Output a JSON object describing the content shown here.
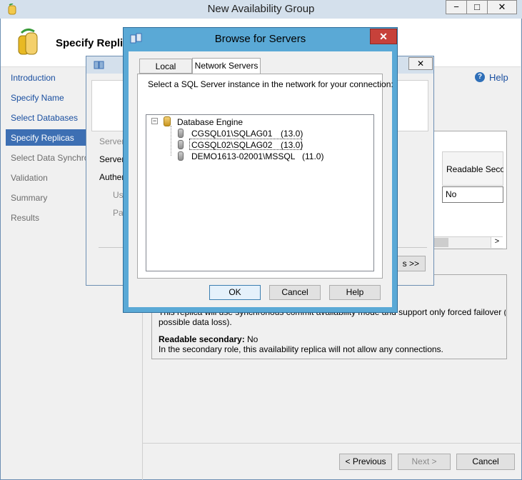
{
  "window": {
    "title": "New Availability Group",
    "minimize": "−",
    "maximize": "□",
    "close": "✕"
  },
  "header": {
    "title": "Specify Repli"
  },
  "nav": {
    "items": [
      {
        "label": "Introduction"
      },
      {
        "label": "Specify Name"
      },
      {
        "label": "Select Databases"
      },
      {
        "label": "Specify Replicas"
      },
      {
        "label": "Select Data Synchro"
      },
      {
        "label": "Validation"
      },
      {
        "label": "Summary"
      },
      {
        "label": "Results"
      }
    ]
  },
  "help_label": "Help",
  "help_glyph": "?",
  "grid": {
    "readable_secondary_header": "Readable Secor",
    "readable_value": "No",
    "scroll_right": ">"
  },
  "desc": {
    "line1": "This replica will use synchronous commit availability mode and support only forced failover (with",
    "line2": "possible data loss).",
    "readable_label": "Readable secondary:",
    "readable_value": "No",
    "readable_desc": "In the secondary role, this availability replica will not allow any connections."
  },
  "bottom": {
    "previous": "< Previous",
    "next": "Next >",
    "cancel": "Cancel"
  },
  "connect_dialog": {
    "close": "✕",
    "server_type_label": "Server",
    "server_name_label": "Server",
    "auth_label": "Authen",
    "user_label": "Use",
    "password_label": "Pas",
    "options_button": "s >>"
  },
  "browse": {
    "title": "Browse for Servers",
    "close": "✕",
    "tabs": [
      "Local Servers",
      "Network Servers"
    ],
    "instruction": "Select a SQL Server instance in the network for your connection:",
    "root_label": "Database Engine",
    "expander": "−",
    "servers": [
      {
        "name": "CGSQL01\\SQLAG01",
        "version": "(13.0)",
        "selected": false
      },
      {
        "name": "CGSQL02\\SQLAG02",
        "version": "(13.0)",
        "selected": true
      },
      {
        "name": "DEMO1613-02001\\MSSQL",
        "version": "(11.0)",
        "selected": false
      }
    ],
    "ok": "OK",
    "cancel": "Cancel",
    "help": "Help"
  },
  "colors": {
    "accent": "#3d6fb3",
    "titlebar": "#d4e0ec",
    "dialog_frame": "#5aa9d6",
    "close_red": "#c7413a"
  }
}
